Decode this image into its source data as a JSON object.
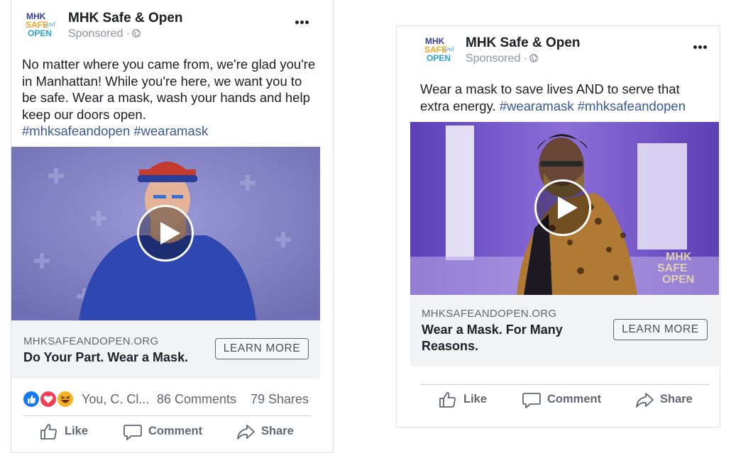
{
  "colors": {
    "brand_blue": "#1877f2",
    "hashtag": "#385898",
    "muted": "#606770",
    "link_bg": "#f2f3f5"
  },
  "ads": [
    {
      "page_name": "MHK Safe & Open",
      "sponsored": "Sponsored ·",
      "text": "No matter where you came from, we're glad you're in Manhattan! While you're here, we want you to be safe. Wear a mask, wash your hands and help keep our doors open.",
      "hashtags": "#mhksafeandopen #wearamask",
      "link_domain": "MHKSAFEANDOPEN.ORG",
      "link_headline": "Do Your Part. Wear a Mask.",
      "cta_label": "LEARN MORE",
      "reaction_names": "You, C. Cl...",
      "comments": "86 Comments",
      "shares": "79 Shares",
      "actions": {
        "like": "Like",
        "comment": "Comment",
        "share": "Share"
      }
    },
    {
      "page_name": "MHK Safe & Open",
      "sponsored": "Sponsored ·",
      "text": "Wear a mask to save lives AND to serve that extra energy.",
      "hashtags": "#wearamask #mhksafeandopen",
      "link_domain": "MHKSAFEANDOPEN.ORG",
      "link_headline": "Wear a Mask. For Many Reasons.",
      "cta_label": "LEARN MORE",
      "actions": {
        "like": "Like",
        "comment": "Comment",
        "share": "Share"
      }
    }
  ],
  "logo": {
    "line1": "MHK",
    "line2": "SAFE",
    "line3": "OPEN",
    "script": "and"
  },
  "watermark": {
    "line1": "MHK",
    "line2": "SAFE",
    "line3": "OPEN"
  }
}
